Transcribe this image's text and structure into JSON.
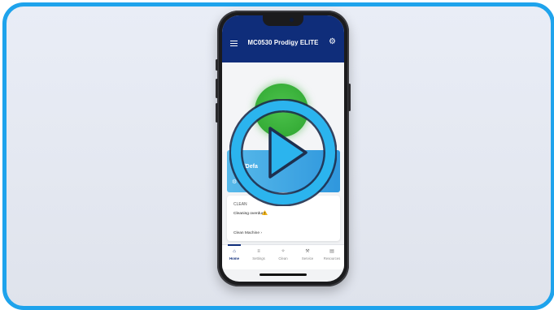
{
  "app": {
    "title": "MC0530 Prodigy ELITE"
  },
  "banner": {
    "text": "r/Defa"
  },
  "status_card": {
    "title": "CLEAN",
    "message": "Cleaning overdue!",
    "link": "Clean Machine ›"
  },
  "tabs": [
    {
      "label": "Home",
      "icon": "home-icon"
    },
    {
      "label": "Settings",
      "icon": "settings-sliders-icon"
    },
    {
      "label": "Clean",
      "icon": "clean-sparkle-icon"
    },
    {
      "label": "Service",
      "icon": "wrench-icon"
    },
    {
      "label": "Resources",
      "icon": "document-icon"
    }
  ],
  "colors": {
    "frame_border": "#1ea3ec",
    "app_bar": "#0f2d7a",
    "status_green": "#36ad37",
    "play_button": "#2bb4ee",
    "banner_blue": "#3ea6e4"
  }
}
